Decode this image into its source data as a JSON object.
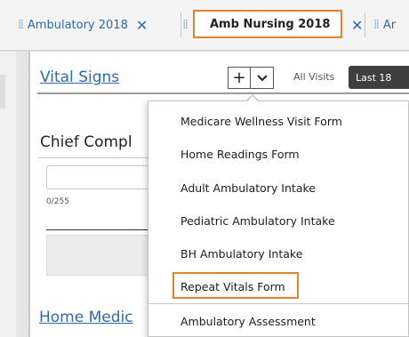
{
  "tabs": [
    {
      "label": "Ambulatory 2018",
      "close": "✕",
      "active": false
    },
    {
      "label": "Amb Nursing 2018",
      "close": "✕",
      "active": true
    },
    {
      "label": "Ar",
      "close": "",
      "active": false
    }
  ],
  "vital_signs": {
    "title": "Vital Signs",
    "add_label": "+",
    "all_visits": "All Visits",
    "last_label": "Last 18"
  },
  "chief_complaint": {
    "title": "Chief Compl",
    "counter": "0/255"
  },
  "home_meds": {
    "title": "Home Medic"
  },
  "menu": {
    "items": [
      {
        "label": "Medicare Wellness Visit Form",
        "highlighted": false
      },
      {
        "label": "Home Readings Form",
        "highlighted": false
      },
      {
        "label": "Adult Ambulatory Intake",
        "highlighted": false
      },
      {
        "label": "Pediatric Ambulatory Intake",
        "highlighted": false
      },
      {
        "label": "BH Ambulatory Intake",
        "highlighted": false
      },
      {
        "label": "Repeat Vitals Form",
        "highlighted": true
      },
      {
        "label": "Ambulatory Assessment",
        "highlighted": false
      }
    ]
  },
  "colors": {
    "link_blue": "#2c6ab1",
    "highlight_orange": "#e0852d",
    "dark_button": "#3e3e3e"
  }
}
